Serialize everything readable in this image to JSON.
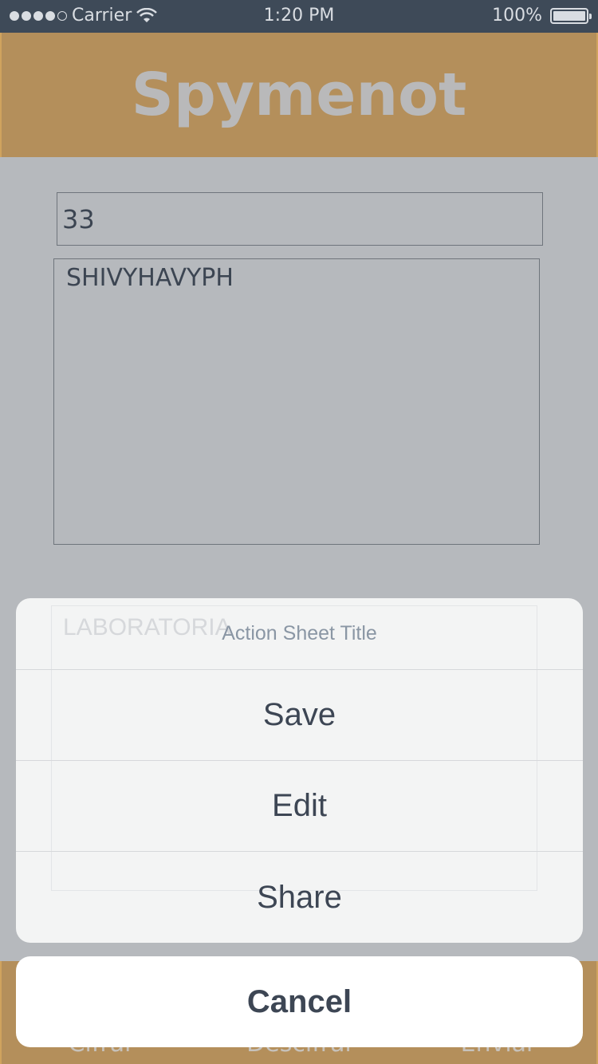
{
  "status_bar": {
    "carrier": "Carrier",
    "time": "1:20 PM",
    "battery": "100%"
  },
  "header": {
    "title": "Spymenot"
  },
  "form": {
    "key_value": "33",
    "message_value": "SHIVYHAVYPH",
    "ghost_text": "LABORATORIA"
  },
  "tab_bar": {
    "items": [
      "Cifrar",
      "Descifrar",
      "Enviar"
    ]
  },
  "action_sheet": {
    "title": "Action Sheet Title",
    "buttons": [
      "Save",
      "Edit",
      "Share"
    ],
    "cancel": "Cancel"
  },
  "colors": {
    "header_bg": "#b48f5b",
    "status_bg": "#3e4a58",
    "overlay_bg": "#b6b9bd",
    "sheet_bg": "#f3f4f4",
    "text_dark": "#3d4654"
  },
  "icons": {
    "signal": "signal-dots-icon",
    "wifi": "wifi-icon",
    "battery": "battery-icon"
  }
}
